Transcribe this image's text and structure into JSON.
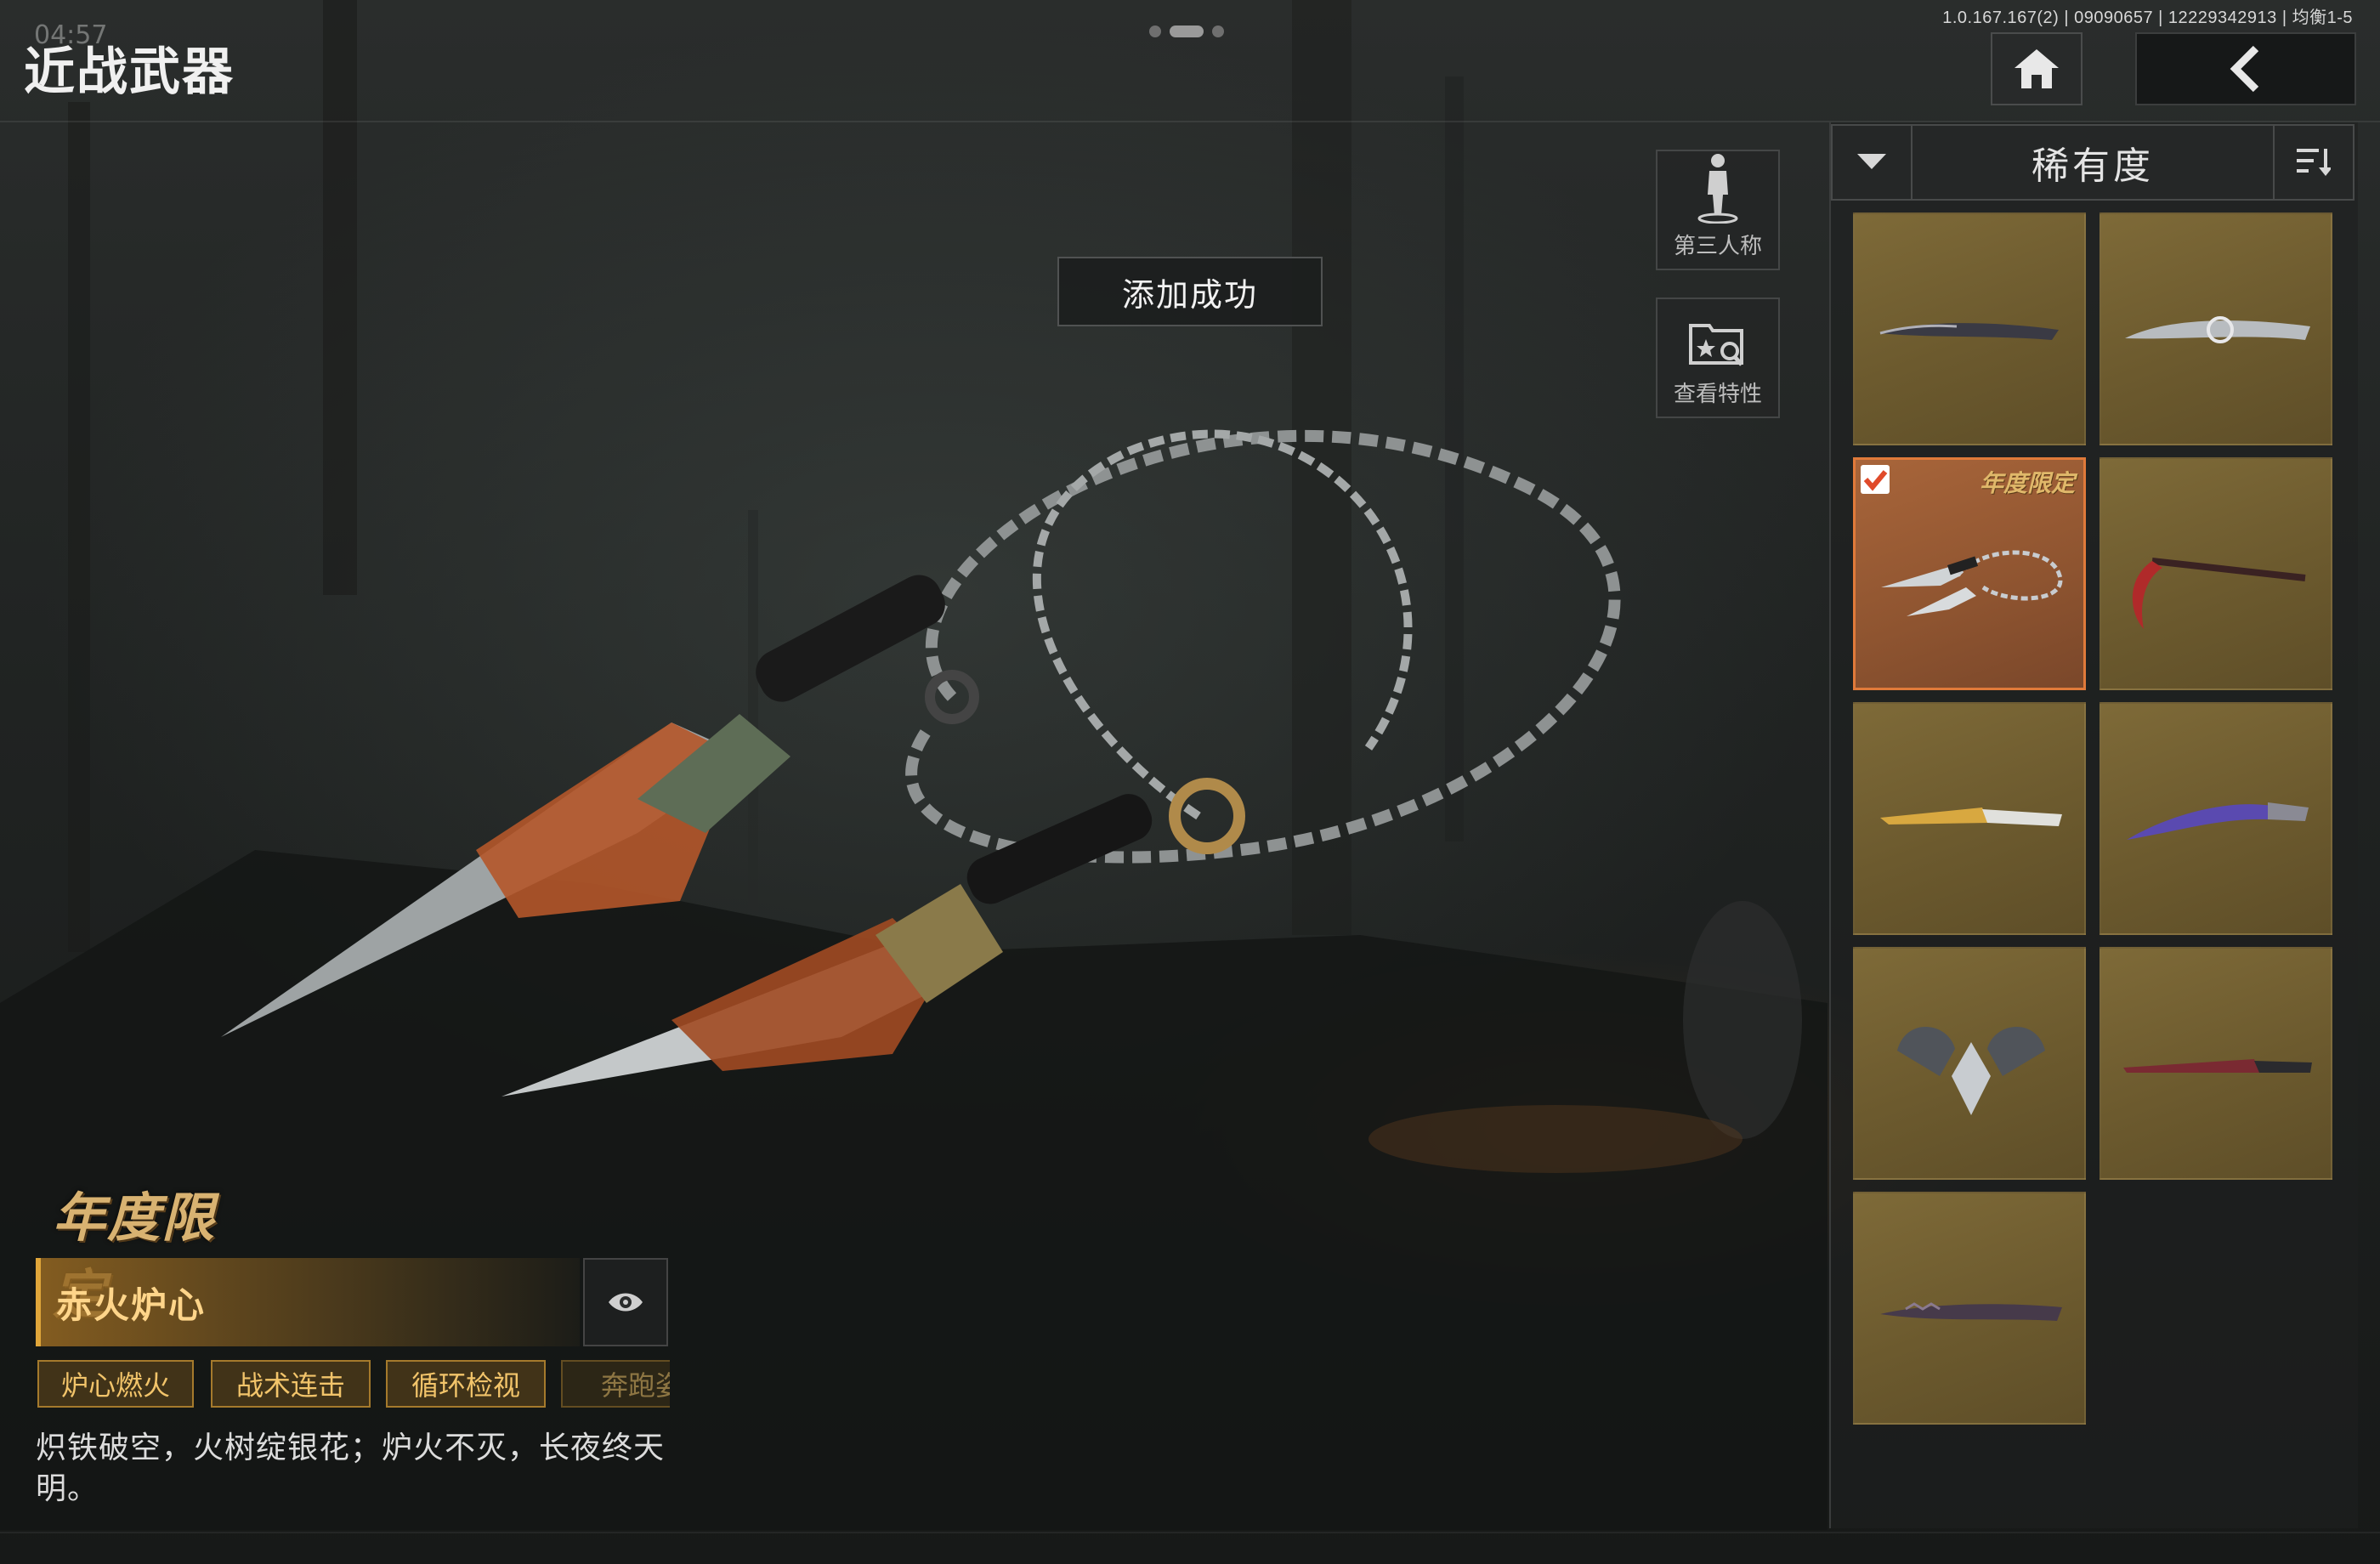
{
  "status_bar": {
    "info": "1.0.167.167(2) | 09090657 | 12229342913 | 均衡1-5",
    "clock": "04:57"
  },
  "header": {
    "title": "近战武器"
  },
  "toast": {
    "message": "添加成功"
  },
  "tools": {
    "third_person_label": "第三人称",
    "view_traits_label": "查看特性"
  },
  "weapon": {
    "badge": "年度限定",
    "name": "赤火炉心",
    "tags": [
      "炉心燃火",
      "战术连击",
      "循环检视",
      "奔跑姿"
    ],
    "description": "炽铁破空，火树绽银花；炉火不灭，长夜终天明。"
  },
  "sort_panel": {
    "title": "稀有度"
  },
  "items": [
    {
      "name": "dark-curved-knife",
      "selected": false,
      "badge": ""
    },
    {
      "name": "silver-ornate-knife",
      "selected": false,
      "badge": ""
    },
    {
      "name": "chain-kunai",
      "selected": true,
      "badge": "年度限定"
    },
    {
      "name": "red-sickle",
      "selected": false,
      "badge": ""
    },
    {
      "name": "gold-combat-knife",
      "selected": false,
      "badge": ""
    },
    {
      "name": "purple-karambit",
      "selected": false,
      "badge": ""
    },
    {
      "name": "winged-claw",
      "selected": false,
      "badge": ""
    },
    {
      "name": "red-pattern-dagger",
      "selected": false,
      "badge": ""
    },
    {
      "name": "dark-serrated-knife",
      "selected": false,
      "badge": ""
    }
  ],
  "colors": {
    "accent_gold": "#e0a63a",
    "card_gold": "#7e6a38",
    "card_selected": "#a8653a",
    "selected_border": "#e07a3a",
    "check_red": "#e04a2a"
  }
}
